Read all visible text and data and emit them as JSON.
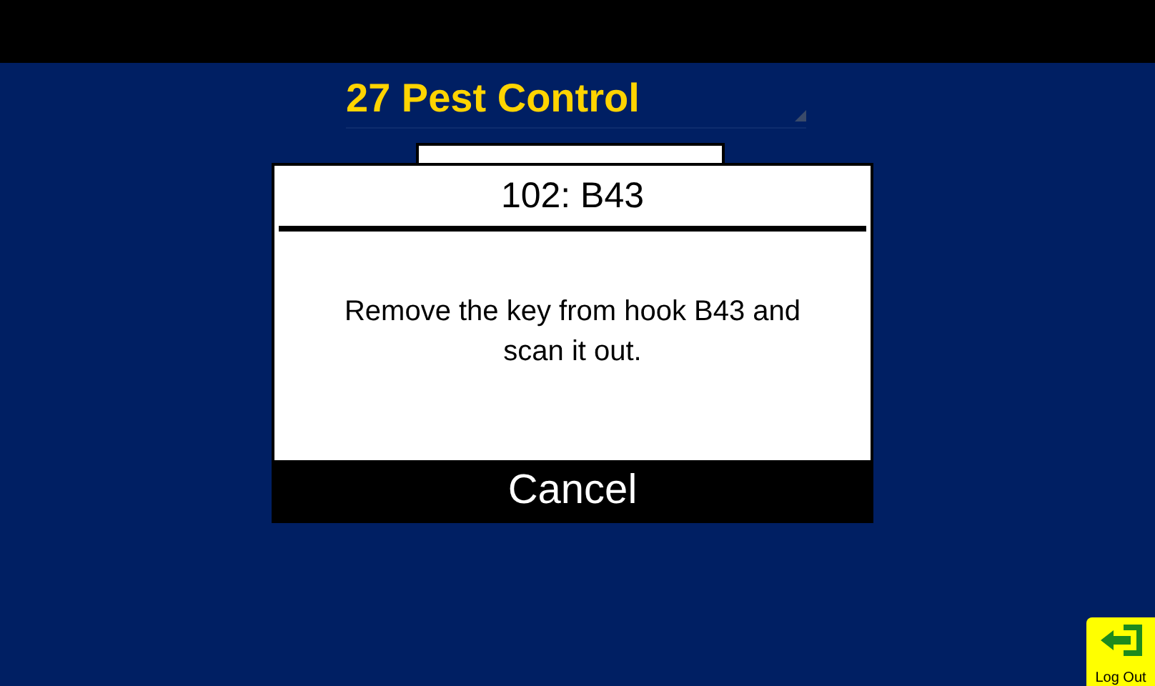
{
  "header": {
    "title": "27 Pest Control"
  },
  "dialog": {
    "title": "102: B43",
    "message": "Remove the key from hook B43 and scan it out.",
    "buttons": [
      "Cancel"
    ]
  },
  "logout_button": {
    "label": "Log Out"
  }
}
